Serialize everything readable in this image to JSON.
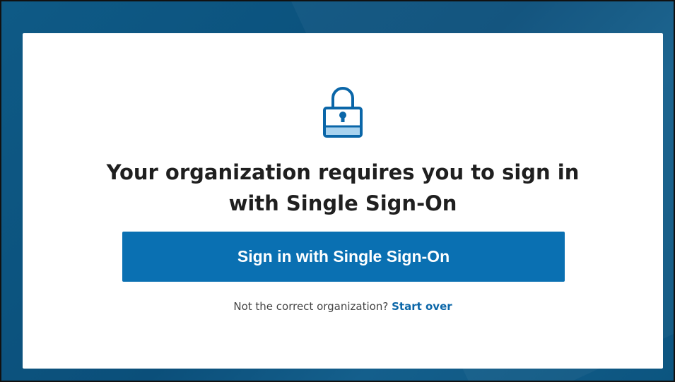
{
  "card": {
    "lock_icon": "lock-icon",
    "headline": "Your organization requires you to sign in with Single Sign-On",
    "sso_button_label": "Sign in with Single Sign-On",
    "prompt_text": "Not the correct organization?",
    "start_over_label": "Start over"
  },
  "colors": {
    "background": "#0e5a86",
    "primary": "#0a70b2",
    "icon": "#0a66a8"
  }
}
